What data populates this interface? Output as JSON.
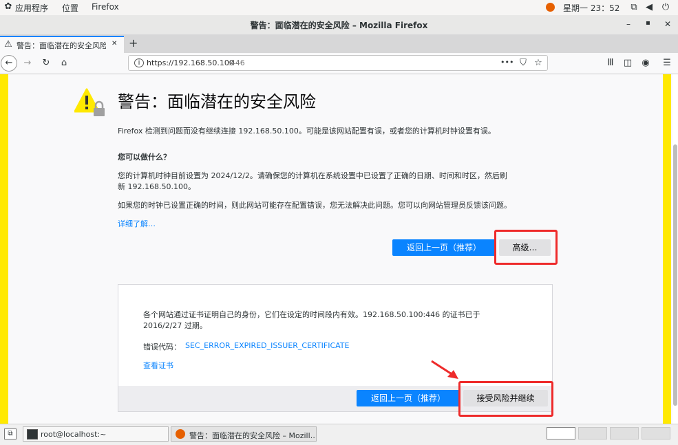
{
  "gnome_bar": {
    "apps_menu": "应用程序",
    "places_menu": "位置",
    "app_name": "Firefox",
    "clock": "星期一 23：52"
  },
  "window": {
    "title": "警告：面临潜在的安全风险 – Mozilla Firefox",
    "minimize": "–",
    "maximize": "▪",
    "close": "✕"
  },
  "tab": {
    "title": "警告：面临潜在的安全风险",
    "close": "✕",
    "new_tab": "+"
  },
  "nav": {
    "url_scheme_host": "https://192.168.50.100",
    "url_port": ":446",
    "page_actions": "•••"
  },
  "error_page": {
    "title": "警告：面临潜在的安全风险",
    "intro": "Firefox 检测到问题而没有继续连接 192.168.50.100。可能是该网站配置有误，或者您的计算机时钟设置有误。",
    "what_heading": "您可以做什么？",
    "clock_note_line1": "您的计算机时钟目前设置为 2024/12/2。请确保您的计算机在系统设置中已设置了正确的日期、时间和时区，然后刷",
    "clock_note_line2": "新 192.168.50.100。",
    "admin_note": "如果您的时钟已设置正确的时间，则此网站可能存在配置错误，您无法解决此问题。您可以向网站管理员反馈该问题。",
    "learn_more": "详细了解…",
    "go_back_button": "返回上一页（推荐）",
    "advanced_button": "高级…"
  },
  "advanced_panel": {
    "description_line1": "各个网站通过证书证明自己的身份，它们在设定的时间段内有效。192.168.50.100:446 的证书已于",
    "description_line2": "2016/2/27 过期。",
    "error_code_label": "错误代码：",
    "error_code": "SEC_ERROR_EXPIRED_ISSUER_CERTIFICATE",
    "view_certificate": "查看证书",
    "go_back_button": "返回上一页（推荐）",
    "accept_button": "接受风险并继续"
  },
  "taskbar": {
    "terminal_task": "root@localhost:~",
    "firefox_task": "警告：面临潜在的安全风险 – Mozill…"
  },
  "colors": {
    "accent_blue": "#0a84ff",
    "warning_yellow": "#ffe900",
    "annotation_red": "#ee2b2b"
  },
  "icons": [
    "apps-menu-icon",
    "firefox-icon",
    "network-icon",
    "volume-icon",
    "power-icon",
    "warning-icon",
    "back-arrow-icon",
    "forward-arrow-icon",
    "reload-icon",
    "home-icon",
    "info-icon",
    "pocket-icon",
    "bookmark-star-icon",
    "library-icon",
    "sidebar-icon",
    "extension-icon",
    "hamburger-menu-icon",
    "terminal-icon",
    "show-desktop-icon",
    "red-arrow-annotation"
  ]
}
